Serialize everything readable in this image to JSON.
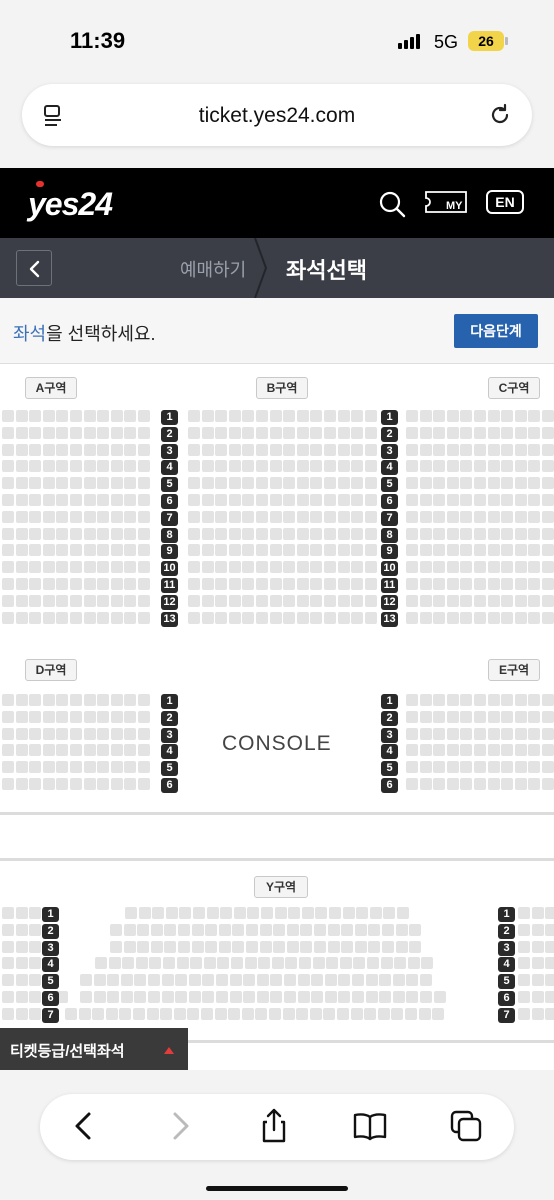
{
  "status_bar": {
    "time": "11:39",
    "network": "5G",
    "battery": "26"
  },
  "browser": {
    "url": "ticket.yes24.com"
  },
  "header": {
    "logo": "yes24",
    "my_label": "MY",
    "lang_button": "EN"
  },
  "nav": {
    "crumb_prev": "예매하기",
    "crumb_current": "좌석선택"
  },
  "instruction": {
    "highlight": "좌석",
    "rest": "을 선택하세요.",
    "next_button": "다음단계"
  },
  "seat_map": {
    "zones": {
      "a": "A구역",
      "b": "B구역",
      "c": "C구역",
      "d": "D구역",
      "e": "E구역",
      "y": "Y구역"
    },
    "console_label": "CONSOLE",
    "upper_rows": [
      "1",
      "2",
      "3",
      "4",
      "5",
      "6",
      "7",
      "8",
      "9",
      "10",
      "11",
      "12",
      "13"
    ],
    "middle_rows": [
      "1",
      "2",
      "3",
      "4",
      "5",
      "6"
    ],
    "y_rows": [
      "1",
      "2",
      "3",
      "4",
      "5",
      "6",
      "7"
    ]
  },
  "legend": {
    "label": "티켓등급/선택좌석"
  },
  "colors": {
    "header_bg": "#000000",
    "nav_bg": "#3b3e47",
    "accent": "#2762ae",
    "seat": "#e3e3e3",
    "row_label": "#2a2a2a"
  }
}
